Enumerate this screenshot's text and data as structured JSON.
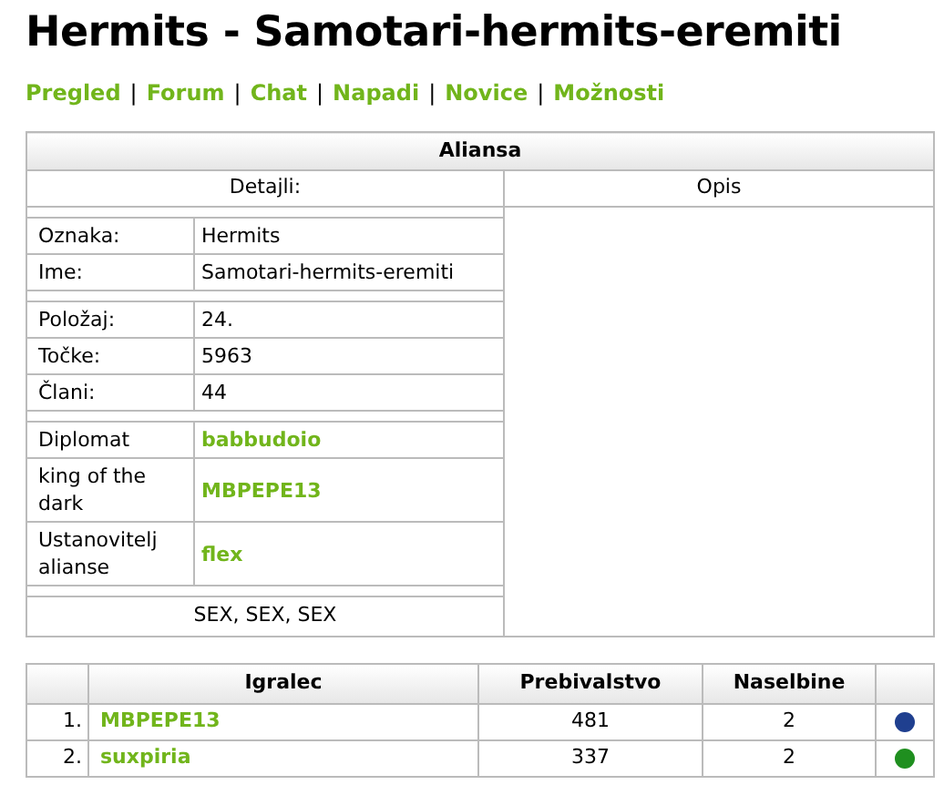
{
  "title": "Hermits - Samotari-hermits-eremiti",
  "nav": [
    "Pregled",
    "Forum",
    "Chat",
    "Napadi",
    "Novice",
    "Možnosti"
  ],
  "nav_separator": "|",
  "alliance": {
    "title": "Aliansa",
    "details_heading": "Detajli:",
    "description_heading": "Opis",
    "groups": [
      [
        {
          "label": "Oznaka:",
          "value": "Hermits",
          "kind": "text"
        },
        {
          "label": "Ime:",
          "value": "Samotari-hermits-eremiti",
          "kind": "text"
        }
      ],
      [
        {
          "label": "Položaj:",
          "value": "24.",
          "kind": "text"
        },
        {
          "label": "Točke:",
          "value": "5963",
          "kind": "text"
        },
        {
          "label": "Člani:",
          "value": "44",
          "kind": "text"
        }
      ],
      [
        {
          "label": "Diplomat",
          "value": "babbudoio",
          "kind": "link"
        },
        {
          "label": "king of the dark",
          "value": "MBPEPE13",
          "kind": "link"
        },
        {
          "label": "Ustanovitelj alianse",
          "value": "flex",
          "kind": "link"
        }
      ]
    ],
    "footer": "SEX, SEX, SEX"
  },
  "members": {
    "columns": [
      "Igralec",
      "Prebivalstvo",
      "Naselbine"
    ],
    "rows": [
      {
        "rank": "1.",
        "player": "MBPEPE13",
        "population": "481",
        "settlements": "2",
        "color": "#1f3f8f"
      },
      {
        "rank": "2.",
        "player": "suxpiria",
        "population": "337",
        "settlements": "2",
        "color": "#1f8f1f"
      }
    ]
  }
}
